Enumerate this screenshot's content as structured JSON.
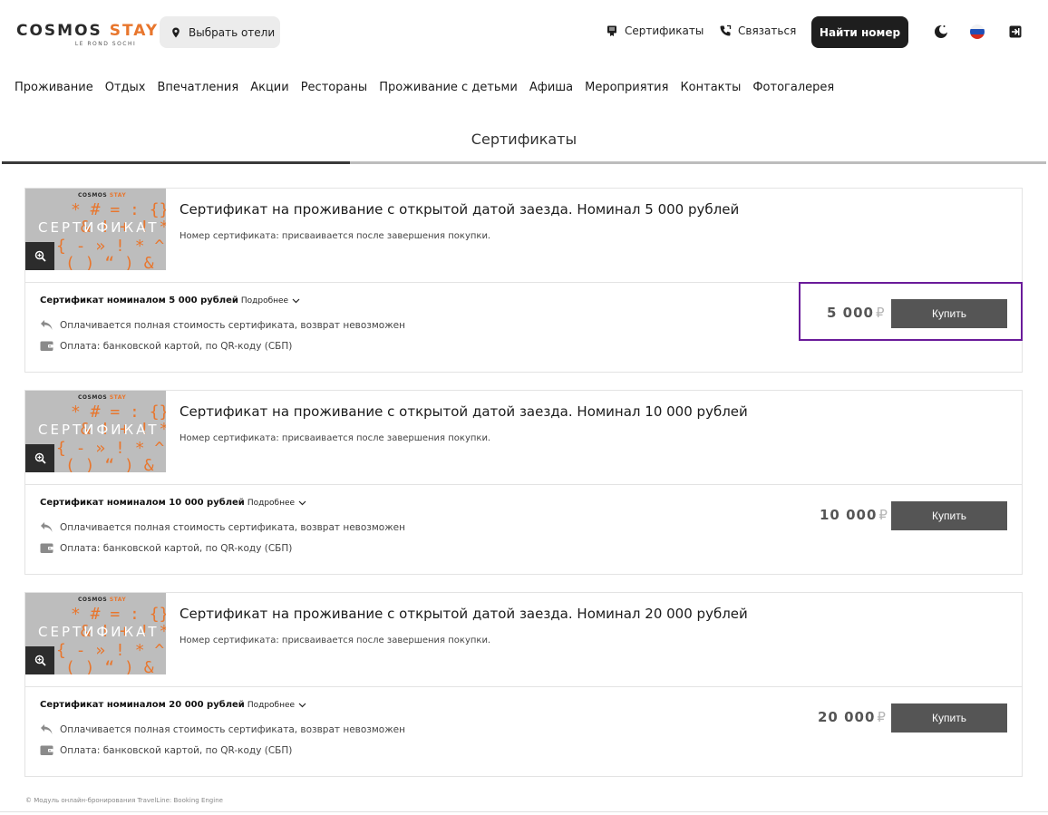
{
  "header": {
    "logo_main": "COSMOS",
    "logo_accent": "STAY",
    "logo_sub": "LE ROND SOCHI",
    "hotel_select": "Выбрать отели",
    "certificates_link": "Сертификаты",
    "contact_link": "Связаться",
    "find_room": "Найти номер"
  },
  "nav": {
    "items": [
      "Проживание",
      "Отдых",
      "Впечатления",
      "Акции",
      "Рестораны",
      "Проживание с детьми",
      "Афиша",
      "Мероприятия",
      "Контакты",
      "Фотогалерея"
    ]
  },
  "tab": {
    "title": "Сертификаты"
  },
  "thumb": {
    "logo_main": "COSMOS",
    "logo_accent": "STAY",
    "word": "СЕРТИФИКАТ",
    "sym1": "* # = : {}",
    "sym2": " & ! + ! *",
    "sym3": "{ - » ! * ^ ?",
    "sym4": "( ) “ ) & ."
  },
  "cards": [
    {
      "title": "Сертификат на проживание с открытой датой заезда. Номинал 5 000 рублей",
      "note": "Номер сертификата: присваивается после завершения покупки.",
      "tariff": "Сертификат номиналом 5 000 рублей",
      "more": "Подробнее",
      "refund": "Оплачивается полная стоимость сертификата, возврат невозможен",
      "payment": "Оплата: банковской картой, по QR-коду (СБП)",
      "price": "5 000",
      "currency": "₽",
      "buy": "Купить"
    },
    {
      "title": "Сертификат на проживание с открытой датой заезда. Номинал 10 000 рублей",
      "note": "Номер сертификата: присваивается после завершения покупки.",
      "tariff": "Сертификат номиналом 10 000 рублей",
      "more": "Подробнее",
      "refund": "Оплачивается полная стоимость сертификата, возврат невозможен",
      "payment": "Оплата: банковской картой, по QR-коду (СБП)",
      "price": "10 000",
      "currency": "₽",
      "buy": "Купить"
    },
    {
      "title": "Сертификат на проживание с открытой датой заезда. Номинал 20 000 рублей",
      "note": "Номер сертификата: присваивается после завершения покупки.",
      "tariff": "Сертификат номиналом 20 000 рублей",
      "more": "Подробнее",
      "refund": "Оплачивается полная стоимость сертификата, возврат невозможен",
      "payment": "Оплата: банковской картой, по QR-коду (СБП)",
      "price": "20 000",
      "currency": "₽",
      "buy": "Купить"
    }
  ],
  "footer": {
    "text": "© Модуль онлайн-бронирования TravelLine: Booking Engine"
  },
  "colors": {
    "accent": "#e8762d",
    "button_dark": "#1e1e1e",
    "buy_button": "#555555",
    "highlight": "#6a1b9a"
  }
}
